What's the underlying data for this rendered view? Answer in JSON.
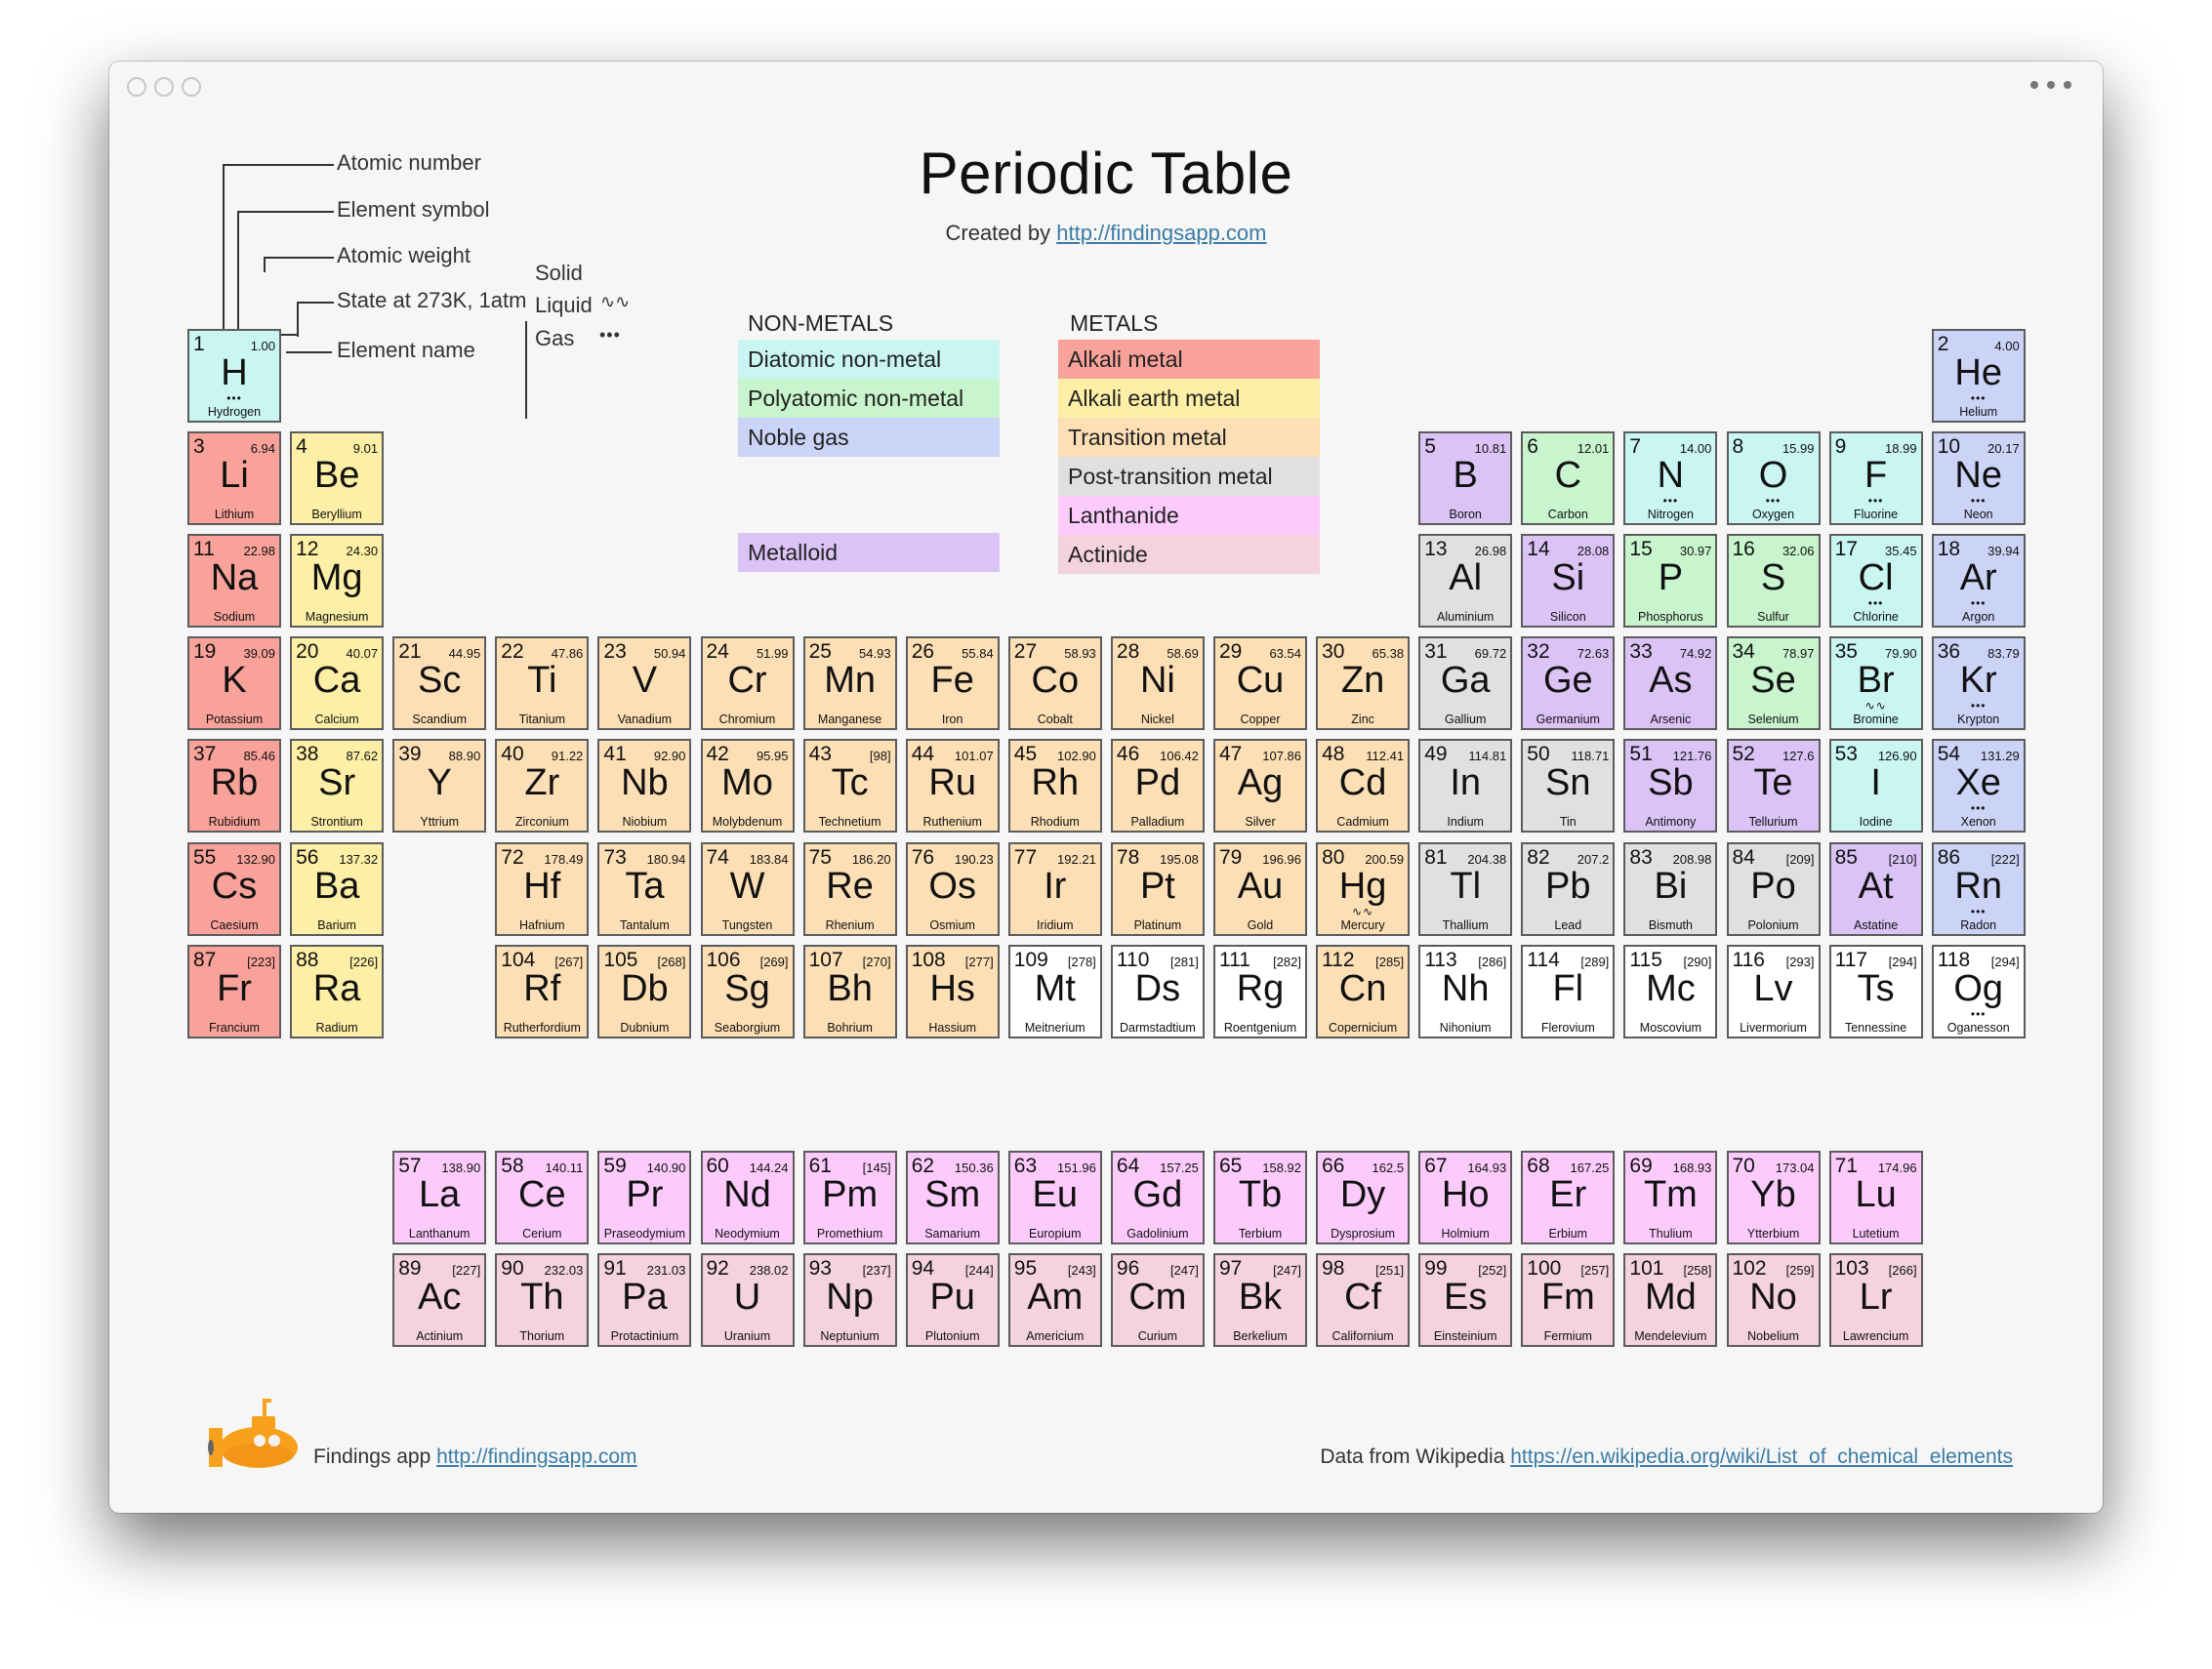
{
  "window": {
    "more_menu": "more-options"
  },
  "header": {
    "title": "Periodic Table",
    "subtitle_prefix": "Created by",
    "subtitle_link": "http://findingsapp.com"
  },
  "key": {
    "example": {
      "number": "1",
      "weight": "1.00",
      "symbol": "H",
      "name": "Hydrogen",
      "state": "gas"
    },
    "labels": {
      "atomic_number": "Atomic number",
      "element_symbol": "Element symbol",
      "atomic_weight": "Atomic weight",
      "state": "State at 273K, 1atm",
      "element_name": "Element name"
    },
    "states": {
      "solid": "Solid",
      "liquid": "Liquid",
      "gas": "Gas",
      "liquid_mark": "∿∿",
      "gas_mark": "•••"
    }
  },
  "legend": {
    "nonmetals_heading": "NON-METALS",
    "metals_heading": "METALS",
    "nonmetals": [
      {
        "key": "diatomic",
        "label": "Diatomic non-metal",
        "color": "#c9f5f3"
      },
      {
        "key": "polyatomic",
        "label": "Polyatomic non-metal",
        "color": "#c8f5cd"
      },
      {
        "key": "noble",
        "label": "Noble gas",
        "color": "#cbd3f6"
      }
    ],
    "metalloid": {
      "key": "metalloid",
      "label": "Metalloid",
      "color": "#dcc3f6"
    },
    "metals": [
      {
        "key": "alkali",
        "label": "Alkali metal",
        "color": "#f9a29a"
      },
      {
        "key": "alkaline",
        "label": "Alkali earth metal",
        "color": "#fdefa5"
      },
      {
        "key": "transition",
        "label": "Transition metal",
        "color": "#fddfb5"
      },
      {
        "key": "post",
        "label": "Post-transition metal",
        "color": "#e0e0e0"
      },
      {
        "key": "lanthanide",
        "label": "Lanthanide",
        "color": "#fccbfc"
      },
      {
        "key": "actinide",
        "label": "Actinide",
        "color": "#f4d2de"
      }
    ],
    "unknown_color": "#ffffff"
  },
  "elements": [
    {
      "n": 1,
      "s": "H",
      "name": "Hydrogen",
      "w": "1.00",
      "cat": "diatomic",
      "st": "gas",
      "r": 1,
      "c": 1
    },
    {
      "n": 2,
      "s": "He",
      "name": "Helium",
      "w": "4.00",
      "cat": "noble",
      "st": "gas",
      "r": 1,
      "c": 18
    },
    {
      "n": 3,
      "s": "Li",
      "name": "Lithium",
      "w": "6.94",
      "cat": "alkali",
      "r": 2,
      "c": 1
    },
    {
      "n": 4,
      "s": "Be",
      "name": "Beryllium",
      "w": "9.01",
      "cat": "alkaline",
      "r": 2,
      "c": 2
    },
    {
      "n": 5,
      "s": "B",
      "name": "Boron",
      "w": "10.81",
      "cat": "metalloid",
      "r": 2,
      "c": 13
    },
    {
      "n": 6,
      "s": "C",
      "name": "Carbon",
      "w": "12.01",
      "cat": "polyatomic",
      "r": 2,
      "c": 14
    },
    {
      "n": 7,
      "s": "N",
      "name": "Nitrogen",
      "w": "14.00",
      "cat": "diatomic",
      "st": "gas",
      "r": 2,
      "c": 15
    },
    {
      "n": 8,
      "s": "O",
      "name": "Oxygen",
      "w": "15.99",
      "cat": "diatomic",
      "st": "gas",
      "r": 2,
      "c": 16
    },
    {
      "n": 9,
      "s": "F",
      "name": "Fluorine",
      "w": "18.99",
      "cat": "diatomic",
      "st": "gas",
      "r": 2,
      "c": 17
    },
    {
      "n": 10,
      "s": "Ne",
      "name": "Neon",
      "w": "20.17",
      "cat": "noble",
      "st": "gas",
      "r": 2,
      "c": 18
    },
    {
      "n": 11,
      "s": "Na",
      "name": "Sodium",
      "w": "22.98",
      "cat": "alkali",
      "r": 3,
      "c": 1
    },
    {
      "n": 12,
      "s": "Mg",
      "name": "Magnesium",
      "w": "24.30",
      "cat": "alkaline",
      "r": 3,
      "c": 2
    },
    {
      "n": 13,
      "s": "Al",
      "name": "Aluminium",
      "w": "26.98",
      "cat": "post",
      "r": 3,
      "c": 13
    },
    {
      "n": 14,
      "s": "Si",
      "name": "Silicon",
      "w": "28.08",
      "cat": "metalloid",
      "r": 3,
      "c": 14
    },
    {
      "n": 15,
      "s": "P",
      "name": "Phosphorus",
      "w": "30.97",
      "cat": "polyatomic",
      "r": 3,
      "c": 15
    },
    {
      "n": 16,
      "s": "S",
      "name": "Sulfur",
      "w": "32.06",
      "cat": "polyatomic",
      "r": 3,
      "c": 16
    },
    {
      "n": 17,
      "s": "Cl",
      "name": "Chlorine",
      "w": "35.45",
      "cat": "diatomic",
      "st": "gas",
      "r": 3,
      "c": 17
    },
    {
      "n": 18,
      "s": "Ar",
      "name": "Argon",
      "w": "39.94",
      "cat": "noble",
      "st": "gas",
      "r": 3,
      "c": 18
    },
    {
      "n": 19,
      "s": "K",
      "name": "Potassium",
      "w": "39.09",
      "cat": "alkali",
      "r": 4,
      "c": 1
    },
    {
      "n": 20,
      "s": "Ca",
      "name": "Calcium",
      "w": "40.07",
      "cat": "alkaline",
      "r": 4,
      "c": 2
    },
    {
      "n": 21,
      "s": "Sc",
      "name": "Scandium",
      "w": "44.95",
      "cat": "transition",
      "r": 4,
      "c": 3
    },
    {
      "n": 22,
      "s": "Ti",
      "name": "Titanium",
      "w": "47.86",
      "cat": "transition",
      "r": 4,
      "c": 4
    },
    {
      "n": 23,
      "s": "V",
      "name": "Vanadium",
      "w": "50.94",
      "cat": "transition",
      "r": 4,
      "c": 5
    },
    {
      "n": 24,
      "s": "Cr",
      "name": "Chromium",
      "w": "51.99",
      "cat": "transition",
      "r": 4,
      "c": 6
    },
    {
      "n": 25,
      "s": "Mn",
      "name": "Manganese",
      "w": "54.93",
      "cat": "transition",
      "r": 4,
      "c": 7
    },
    {
      "n": 26,
      "s": "Fe",
      "name": "Iron",
      "w": "55.84",
      "cat": "transition",
      "r": 4,
      "c": 8
    },
    {
      "n": 27,
      "s": "Co",
      "name": "Cobalt",
      "w": "58.93",
      "cat": "transition",
      "r": 4,
      "c": 9
    },
    {
      "n": 28,
      "s": "Ni",
      "name": "Nickel",
      "w": "58.69",
      "cat": "transition",
      "r": 4,
      "c": 10
    },
    {
      "n": 29,
      "s": "Cu",
      "name": "Copper",
      "w": "63.54",
      "cat": "transition",
      "r": 4,
      "c": 11
    },
    {
      "n": 30,
      "s": "Zn",
      "name": "Zinc",
      "w": "65.38",
      "cat": "transition",
      "r": 4,
      "c": 12
    },
    {
      "n": 31,
      "s": "Ga",
      "name": "Gallium",
      "w": "69.72",
      "cat": "post",
      "r": 4,
      "c": 13
    },
    {
      "n": 32,
      "s": "Ge",
      "name": "Germanium",
      "w": "72.63",
      "cat": "metalloid",
      "r": 4,
      "c": 14
    },
    {
      "n": 33,
      "s": "As",
      "name": "Arsenic",
      "w": "74.92",
      "cat": "metalloid",
      "r": 4,
      "c": 15
    },
    {
      "n": 34,
      "s": "Se",
      "name": "Selenium",
      "w": "78.97",
      "cat": "polyatomic",
      "r": 4,
      "c": 16
    },
    {
      "n": 35,
      "s": "Br",
      "name": "Bromine",
      "w": "79.90",
      "cat": "diatomic",
      "st": "liquid",
      "r": 4,
      "c": 17
    },
    {
      "n": 36,
      "s": "Kr",
      "name": "Krypton",
      "w": "83.79",
      "cat": "noble",
      "st": "gas",
      "r": 4,
      "c": 18
    },
    {
      "n": 37,
      "s": "Rb",
      "name": "Rubidium",
      "w": "85.46",
      "cat": "alkali",
      "r": 5,
      "c": 1
    },
    {
      "n": 38,
      "s": "Sr",
      "name": "Strontium",
      "w": "87.62",
      "cat": "alkaline",
      "r": 5,
      "c": 2
    },
    {
      "n": 39,
      "s": "Y",
      "name": "Yttrium",
      "w": "88.90",
      "cat": "transition",
      "r": 5,
      "c": 3
    },
    {
      "n": 40,
      "s": "Zr",
      "name": "Zirconium",
      "w": "91.22",
      "cat": "transition",
      "r": 5,
      "c": 4
    },
    {
      "n": 41,
      "s": "Nb",
      "name": "Niobium",
      "w": "92.90",
      "cat": "transition",
      "r": 5,
      "c": 5
    },
    {
      "n": 42,
      "s": "Mo",
      "name": "Molybdenum",
      "w": "95.95",
      "cat": "transition",
      "r": 5,
      "c": 6
    },
    {
      "n": 43,
      "s": "Tc",
      "name": "Technetium",
      "w": "[98]",
      "cat": "transition",
      "r": 5,
      "c": 7
    },
    {
      "n": 44,
      "s": "Ru",
      "name": "Ruthenium",
      "w": "101.07",
      "cat": "transition",
      "r": 5,
      "c": 8
    },
    {
      "n": 45,
      "s": "Rh",
      "name": "Rhodium",
      "w": "102.90",
      "cat": "transition",
      "r": 5,
      "c": 9
    },
    {
      "n": 46,
      "s": "Pd",
      "name": "Palladium",
      "w": "106.42",
      "cat": "transition",
      "r": 5,
      "c": 10
    },
    {
      "n": 47,
      "s": "Ag",
      "name": "Silver",
      "w": "107.86",
      "cat": "transition",
      "r": 5,
      "c": 11
    },
    {
      "n": 48,
      "s": "Cd",
      "name": "Cadmium",
      "w": "112.41",
      "cat": "transition",
      "r": 5,
      "c": 12
    },
    {
      "n": 49,
      "s": "In",
      "name": "Indium",
      "w": "114.81",
      "cat": "post",
      "r": 5,
      "c": 13
    },
    {
      "n": 50,
      "s": "Sn",
      "name": "Tin",
      "w": "118.71",
      "cat": "post",
      "r": 5,
      "c": 14
    },
    {
      "n": 51,
      "s": "Sb",
      "name": "Antimony",
      "w": "121.76",
      "cat": "metalloid",
      "r": 5,
      "c": 15
    },
    {
      "n": 52,
      "s": "Te",
      "name": "Tellurium",
      "w": "127.6",
      "cat": "metalloid",
      "r": 5,
      "c": 16
    },
    {
      "n": 53,
      "s": "I",
      "name": "Iodine",
      "w": "126.90",
      "cat": "diatomic",
      "r": 5,
      "c": 17
    },
    {
      "n": 54,
      "s": "Xe",
      "name": "Xenon",
      "w": "131.29",
      "cat": "noble",
      "st": "gas",
      "r": 5,
      "c": 18
    },
    {
      "n": 55,
      "s": "Cs",
      "name": "Caesium",
      "w": "132.90",
      "cat": "alkali",
      "r": 6,
      "c": 1
    },
    {
      "n": 56,
      "s": "Ba",
      "name": "Barium",
      "w": "137.32",
      "cat": "alkaline",
      "r": 6,
      "c": 2
    },
    {
      "n": 72,
      "s": "Hf",
      "name": "Hafnium",
      "w": "178.49",
      "cat": "transition",
      "r": 6,
      "c": 4
    },
    {
      "n": 73,
      "s": "Ta",
      "name": "Tantalum",
      "w": "180.94",
      "cat": "transition",
      "r": 6,
      "c": 5
    },
    {
      "n": 74,
      "s": "W",
      "name": "Tungsten",
      "w": "183.84",
      "cat": "transition",
      "r": 6,
      "c": 6
    },
    {
      "n": 75,
      "s": "Re",
      "name": "Rhenium",
      "w": "186.20",
      "cat": "transition",
      "r": 6,
      "c": 7
    },
    {
      "n": 76,
      "s": "Os",
      "name": "Osmium",
      "w": "190.23",
      "cat": "transition",
      "r": 6,
      "c": 8
    },
    {
      "n": 77,
      "s": "Ir",
      "name": "Iridium",
      "w": "192.21",
      "cat": "transition",
      "r": 6,
      "c": 9
    },
    {
      "n": 78,
      "s": "Pt",
      "name": "Platinum",
      "w": "195.08",
      "cat": "transition",
      "r": 6,
      "c": 10
    },
    {
      "n": 79,
      "s": "Au",
      "name": "Gold",
      "w": "196.96",
      "cat": "transition",
      "r": 6,
      "c": 11
    },
    {
      "n": 80,
      "s": "Hg",
      "name": "Mercury",
      "w": "200.59",
      "cat": "transition",
      "st": "liquid",
      "r": 6,
      "c": 12
    },
    {
      "n": 81,
      "s": "Tl",
      "name": "Thallium",
      "w": "204.38",
      "cat": "post",
      "r": 6,
      "c": 13
    },
    {
      "n": 82,
      "s": "Pb",
      "name": "Lead",
      "w": "207.2",
      "cat": "post",
      "r": 6,
      "c": 14
    },
    {
      "n": 83,
      "s": "Bi",
      "name": "Bismuth",
      "w": "208.98",
      "cat": "post",
      "r": 6,
      "c": 15
    },
    {
      "n": 84,
      "s": "Po",
      "name": "Polonium",
      "w": "[209]",
      "cat": "post",
      "r": 6,
      "c": 16
    },
    {
      "n": 85,
      "s": "At",
      "name": "Astatine",
      "w": "[210]",
      "cat": "metalloid",
      "r": 6,
      "c": 17
    },
    {
      "n": 86,
      "s": "Rn",
      "name": "Radon",
      "w": "[222]",
      "cat": "noble",
      "st": "gas",
      "r": 6,
      "c": 18
    },
    {
      "n": 87,
      "s": "Fr",
      "name": "Francium",
      "w": "[223]",
      "cat": "alkali",
      "r": 7,
      "c": 1
    },
    {
      "n": 88,
      "s": "Ra",
      "name": "Radium",
      "w": "[226]",
      "cat": "alkaline",
      "r": 7,
      "c": 2
    },
    {
      "n": 104,
      "s": "Rf",
      "name": "Rutherfordium",
      "w": "[267]",
      "cat": "transition",
      "r": 7,
      "c": 4
    },
    {
      "n": 105,
      "s": "Db",
      "name": "Dubnium",
      "w": "[268]",
      "cat": "transition",
      "r": 7,
      "c": 5
    },
    {
      "n": 106,
      "s": "Sg",
      "name": "Seaborgium",
      "w": "[269]",
      "cat": "transition",
      "r": 7,
      "c": 6
    },
    {
      "n": 107,
      "s": "Bh",
      "name": "Bohrium",
      "w": "[270]",
      "cat": "transition",
      "r": 7,
      "c": 7
    },
    {
      "n": 108,
      "s": "Hs",
      "name": "Hassium",
      "w": "[277]",
      "cat": "transition",
      "r": 7,
      "c": 8
    },
    {
      "n": 109,
      "s": "Mt",
      "name": "Meitnerium",
      "w": "[278]",
      "cat": "unknown",
      "r": 7,
      "c": 9
    },
    {
      "n": 110,
      "s": "Ds",
      "name": "Darmstadtium",
      "w": "[281]",
      "cat": "unknown",
      "r": 7,
      "c": 10
    },
    {
      "n": 111,
      "s": "Rg",
      "name": "Roentgenium",
      "w": "[282]",
      "cat": "unknown",
      "r": 7,
      "c": 11
    },
    {
      "n": 112,
      "s": "Cn",
      "name": "Copernicium",
      "w": "[285]",
      "cat": "transition",
      "r": 7,
      "c": 12
    },
    {
      "n": 113,
      "s": "Nh",
      "name": "Nihonium",
      "w": "[286]",
      "cat": "unknown",
      "r": 7,
      "c": 13
    },
    {
      "n": 114,
      "s": "Fl",
      "name": "Flerovium",
      "w": "[289]",
      "cat": "unknown",
      "r": 7,
      "c": 14
    },
    {
      "n": 115,
      "s": "Mc",
      "name": "Moscovium",
      "w": "[290]",
      "cat": "unknown",
      "r": 7,
      "c": 15
    },
    {
      "n": 116,
      "s": "Lv",
      "name": "Livermorium",
      "w": "[293]",
      "cat": "unknown",
      "r": 7,
      "c": 16
    },
    {
      "n": 117,
      "s": "Ts",
      "name": "Tennessine",
      "w": "[294]",
      "cat": "unknown",
      "r": 7,
      "c": 17
    },
    {
      "n": 118,
      "s": "Og",
      "name": "Oganesson",
      "w": "[294]",
      "cat": "unknown",
      "st": "gas",
      "r": 7,
      "c": 18
    },
    {
      "n": 57,
      "s": "La",
      "name": "Lanthanum",
      "w": "138.90",
      "cat": "lanthanide",
      "r": 9,
      "c": 3
    },
    {
      "n": 58,
      "s": "Ce",
      "name": "Cerium",
      "w": "140.11",
      "cat": "lanthanide",
      "r": 9,
      "c": 4
    },
    {
      "n": 59,
      "s": "Pr",
      "name": "Praseodymium",
      "w": "140.90",
      "cat": "lanthanide",
      "r": 9,
      "c": 5
    },
    {
      "n": 60,
      "s": "Nd",
      "name": "Neodymium",
      "w": "144.24",
      "cat": "lanthanide",
      "r": 9,
      "c": 6
    },
    {
      "n": 61,
      "s": "Pm",
      "name": "Promethium",
      "w": "[145]",
      "cat": "lanthanide",
      "r": 9,
      "c": 7
    },
    {
      "n": 62,
      "s": "Sm",
      "name": "Samarium",
      "w": "150.36",
      "cat": "lanthanide",
      "r": 9,
      "c": 8
    },
    {
      "n": 63,
      "s": "Eu",
      "name": "Europium",
      "w": "151.96",
      "cat": "lanthanide",
      "r": 9,
      "c": 9
    },
    {
      "n": 64,
      "s": "Gd",
      "name": "Gadolinium",
      "w": "157.25",
      "cat": "lanthanide",
      "r": 9,
      "c": 10
    },
    {
      "n": 65,
      "s": "Tb",
      "name": "Terbium",
      "w": "158.92",
      "cat": "lanthanide",
      "r": 9,
      "c": 11
    },
    {
      "n": 66,
      "s": "Dy",
      "name": "Dysprosium",
      "w": "162.5",
      "cat": "lanthanide",
      "r": 9,
      "c": 12
    },
    {
      "n": 67,
      "s": "Ho",
      "name": "Holmium",
      "w": "164.93",
      "cat": "lanthanide",
      "r": 9,
      "c": 13
    },
    {
      "n": 68,
      "s": "Er",
      "name": "Erbium",
      "w": "167.25",
      "cat": "lanthanide",
      "r": 9,
      "c": 14
    },
    {
      "n": 69,
      "s": "Tm",
      "name": "Thulium",
      "w": "168.93",
      "cat": "lanthanide",
      "r": 9,
      "c": 15
    },
    {
      "n": 70,
      "s": "Yb",
      "name": "Ytterbium",
      "w": "173.04",
      "cat": "lanthanide",
      "r": 9,
      "c": 16
    },
    {
      "n": 71,
      "s": "Lu",
      "name": "Lutetium",
      "w": "174.96",
      "cat": "lanthanide",
      "r": 9,
      "c": 17
    },
    {
      "n": 89,
      "s": "Ac",
      "name": "Actinium",
      "w": "[227]",
      "cat": "actinide",
      "r": 10,
      "c": 3
    },
    {
      "n": 90,
      "s": "Th",
      "name": "Thorium",
      "w": "232.03",
      "cat": "actinide",
      "r": 10,
      "c": 4
    },
    {
      "n": 91,
      "s": "Pa",
      "name": "Protactinium",
      "w": "231.03",
      "cat": "actinide",
      "r": 10,
      "c": 5
    },
    {
      "n": 92,
      "s": "U",
      "name": "Uranium",
      "w": "238.02",
      "cat": "actinide",
      "r": 10,
      "c": 6
    },
    {
      "n": 93,
      "s": "Np",
      "name": "Neptunium",
      "w": "[237]",
      "cat": "actinide",
      "r": 10,
      "c": 7
    },
    {
      "n": 94,
      "s": "Pu",
      "name": "Plutonium",
      "w": "[244]",
      "cat": "actinide",
      "r": 10,
      "c": 8
    },
    {
      "n": 95,
      "s": "Am",
      "name": "Americium",
      "w": "[243]",
      "cat": "actinide",
      "r": 10,
      "c": 9
    },
    {
      "n": 96,
      "s": "Cm",
      "name": "Curium",
      "w": "[247]",
      "cat": "actinide",
      "r": 10,
      "c": 10
    },
    {
      "n": 97,
      "s": "Bk",
      "name": "Berkelium",
      "w": "[247]",
      "cat": "actinide",
      "r": 10,
      "c": 11
    },
    {
      "n": 98,
      "s": "Cf",
      "name": "Californium",
      "w": "[251]",
      "cat": "actinide",
      "r": 10,
      "c": 12
    },
    {
      "n": 99,
      "s": "Es",
      "name": "Einsteinium",
      "w": "[252]",
      "cat": "actinide",
      "r": 10,
      "c": 13
    },
    {
      "n": 100,
      "s": "Fm",
      "name": "Fermium",
      "w": "[257]",
      "cat": "actinide",
      "r": 10,
      "c": 14
    },
    {
      "n": 101,
      "s": "Md",
      "name": "Mendelevium",
      "w": "[258]",
      "cat": "actinide",
      "r": 10,
      "c": 15
    },
    {
      "n": 102,
      "s": "No",
      "name": "Nobelium",
      "w": "[259]",
      "cat": "actinide",
      "r": 10,
      "c": 16
    },
    {
      "n": 103,
      "s": "Lr",
      "name": "Lawrencium",
      "w": "[266]",
      "cat": "actinide",
      "r": 10,
      "c": 17
    }
  ],
  "footer": {
    "app_label": "Findings app",
    "app_link": "http://findingsapp.com",
    "source_label": "Data from Wikipedia",
    "source_link": "https://en.wikipedia.org/wiki/List_of_chemical_elements"
  }
}
